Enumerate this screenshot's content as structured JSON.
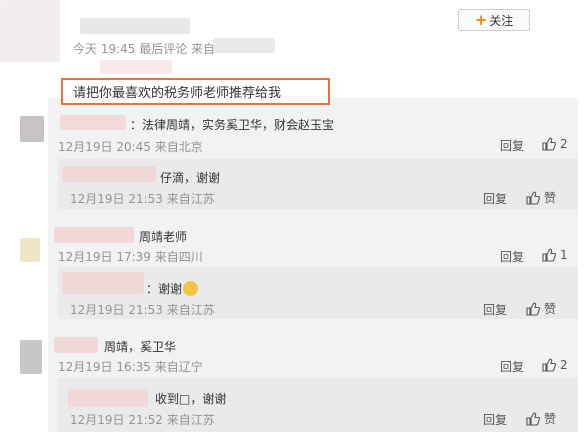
{
  "follow_button": {
    "label": "关注"
  },
  "post": {
    "meta": "今天 19:45 最后评论 来自",
    "text": "请把你最喜欢的税务师老师推荐给我"
  },
  "labels": {
    "reply": "回复",
    "like": "赞"
  },
  "comments": [
    {
      "text": "：法律周靖，实务奚卫华，财会赵玉宝",
      "time": "12月19日 20:45 来自北京",
      "likes": "2",
      "reply": {
        "text": "仔滴，谢谢",
        "time": "12月19日 21:53 来自江苏",
        "likes": "赞"
      }
    },
    {
      "text": "周靖老师",
      "time": "12月19日 17:39 来自四川",
      "likes": "1",
      "reply": {
        "text": "：谢谢",
        "time": "12月19日 21:53 来自江苏",
        "likes": "赞"
      }
    },
    {
      "text": "周靖，奚卫华",
      "time": "12月19日 16:35 来自辽宁",
      "likes": "2",
      "reply": {
        "text": "收到□，谢谢",
        "time": "12月19日 21:52 来自江苏",
        "likes": "赞"
      }
    }
  ]
}
